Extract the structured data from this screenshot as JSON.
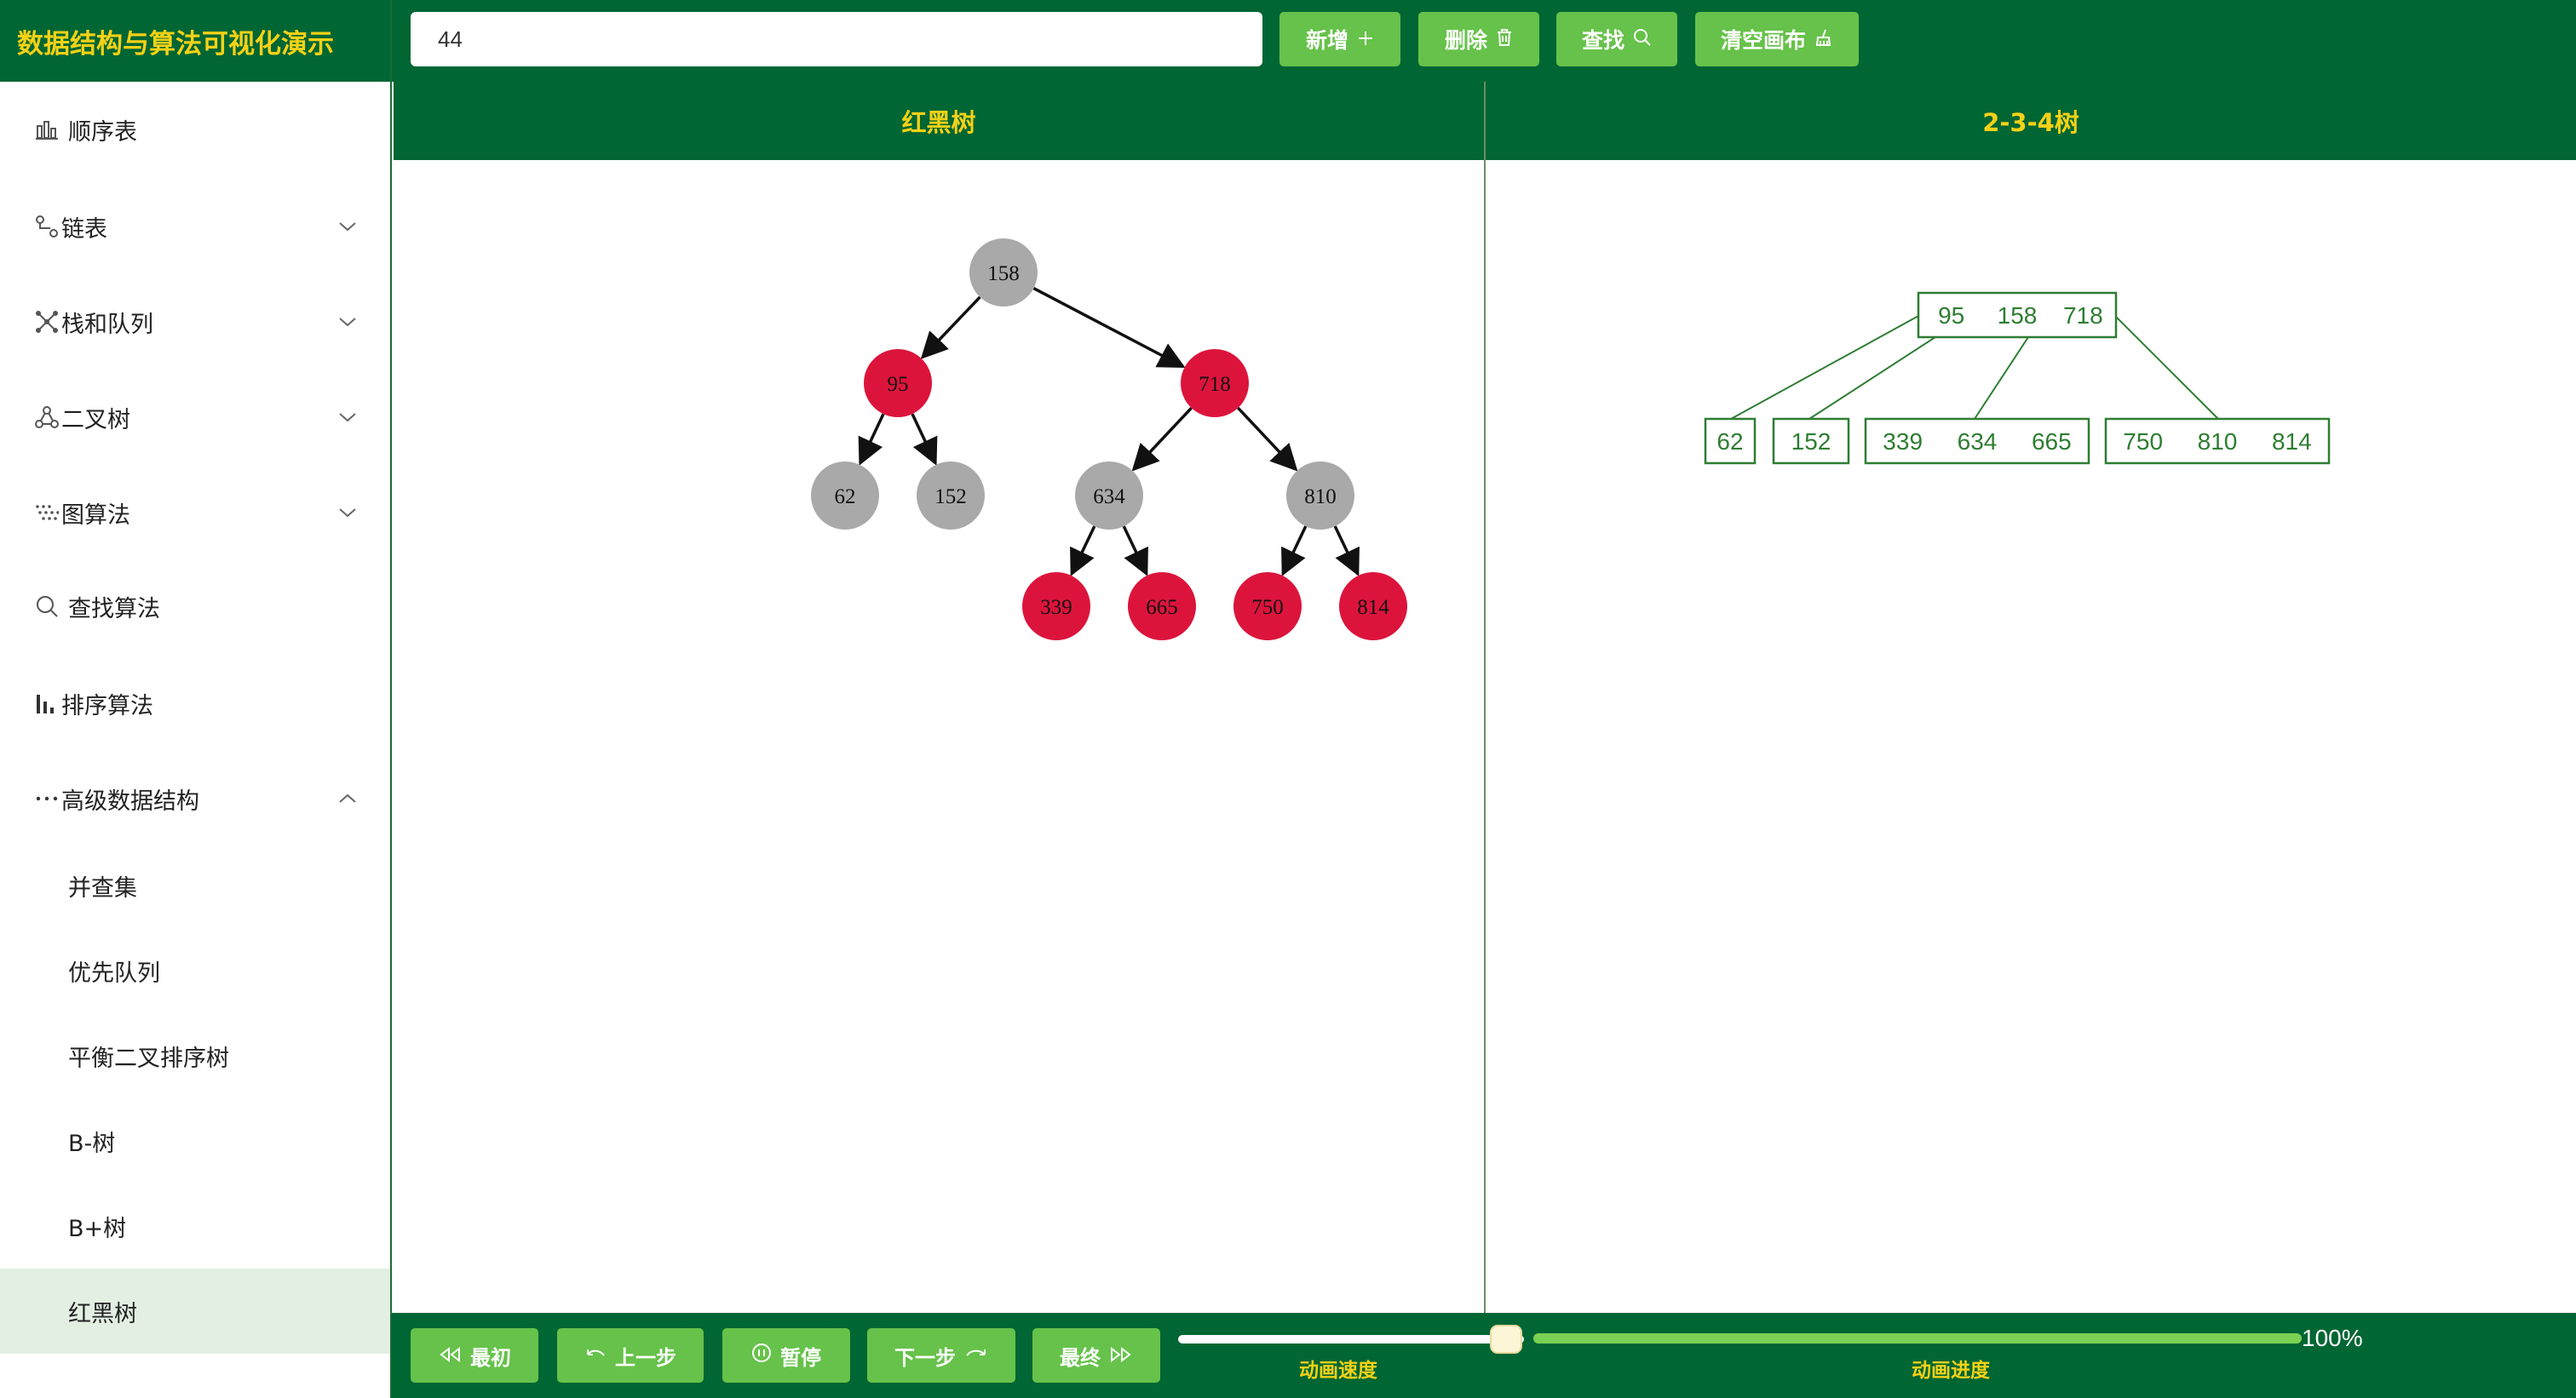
{
  "app": {
    "title": "数据结构与算法可视化演示"
  },
  "sidebar": {
    "items": [
      {
        "label": "顺序表",
        "icon": "bar-list-icon",
        "expandable": false
      },
      {
        "label": "链表",
        "icon": "linked-nodes-icon",
        "expandable": true,
        "expanded": false
      },
      {
        "label": "栈和队列",
        "icon": "share-nodes-icon",
        "expandable": true,
        "expanded": false
      },
      {
        "label": "二叉树",
        "icon": "tree-nodes-icon",
        "expandable": true,
        "expanded": false
      },
      {
        "label": "图算法",
        "icon": "dot-grid-icon",
        "expandable": true,
        "expanded": false
      },
      {
        "label": "查找算法",
        "icon": "search-icon",
        "expandable": false
      },
      {
        "label": "排序算法",
        "icon": "bar-chart-icon",
        "expandable": false
      },
      {
        "label": "高级数据结构",
        "icon": "more-dots-icon",
        "expandable": true,
        "expanded": true
      }
    ],
    "sub_items": [
      {
        "label": "并查集",
        "active": false
      },
      {
        "label": "优先队列",
        "active": false
      },
      {
        "label": "平衡二叉排序树",
        "active": false
      },
      {
        "label": "B-树",
        "active": false
      },
      {
        "label": "B+树",
        "active": false
      },
      {
        "label": "红黑树",
        "active": true
      }
    ]
  },
  "toolbar": {
    "input_value": "44",
    "buttons": [
      {
        "label": "新增",
        "icon": "plus-icon"
      },
      {
        "label": "删除",
        "icon": "trash-icon"
      },
      {
        "label": "查找",
        "icon": "search-icon"
      },
      {
        "label": "清空画布",
        "icon": "broom-icon"
      }
    ]
  },
  "panels": {
    "left_title": "红黑树",
    "right_title": "2-3-4树"
  },
  "rb_tree": {
    "colors": {
      "red": "#dc143c",
      "black": "#a9a9a9"
    },
    "nodes": [
      {
        "id": "n158",
        "value": "158",
        "color": "black"
      },
      {
        "id": "n95",
        "value": "95",
        "color": "red"
      },
      {
        "id": "n718",
        "value": "718",
        "color": "red"
      },
      {
        "id": "n62",
        "value": "62",
        "color": "black"
      },
      {
        "id": "n152",
        "value": "152",
        "color": "black"
      },
      {
        "id": "n634",
        "value": "634",
        "color": "black"
      },
      {
        "id": "n810",
        "value": "810",
        "color": "black"
      },
      {
        "id": "n339",
        "value": "339",
        "color": "red"
      },
      {
        "id": "n665",
        "value": "665",
        "color": "red"
      },
      {
        "id": "n750",
        "value": "750",
        "color": "red"
      },
      {
        "id": "n814",
        "value": "814",
        "color": "red"
      }
    ],
    "edges": [
      [
        "n158",
        "n95"
      ],
      [
        "n158",
        "n718"
      ],
      [
        "n95",
        "n62"
      ],
      [
        "n95",
        "n152"
      ],
      [
        "n718",
        "n634"
      ],
      [
        "n718",
        "n810"
      ],
      [
        "n634",
        "n339"
      ],
      [
        "n634",
        "n665"
      ],
      [
        "n810",
        "n750"
      ],
      [
        "n810",
        "n814"
      ]
    ]
  },
  "tree234": {
    "root": {
      "keys": [
        "95",
        "158",
        "718"
      ]
    },
    "children": [
      {
        "keys": [
          "62"
        ]
      },
      {
        "keys": [
          "152"
        ]
      },
      {
        "keys": [
          "339",
          "634",
          "665"
        ]
      },
      {
        "keys": [
          "750",
          "810",
          "814"
        ]
      }
    ],
    "color": "#2e7d32"
  },
  "controls": {
    "buttons": [
      {
        "label": "最初",
        "icon": "rewind-icon"
      },
      {
        "label": "上一步",
        "icon": "undo-icon"
      },
      {
        "label": "暂停",
        "icon": "pause-icon"
      },
      {
        "label": "下一步",
        "icon": "redo-icon"
      },
      {
        "label": "最终",
        "icon": "fast-forward-icon"
      }
    ],
    "speed_label": "动画速度",
    "speed_fraction": 0.95,
    "progress_label": "动画进度",
    "progress_percent": 100,
    "progress_text": "100%"
  }
}
